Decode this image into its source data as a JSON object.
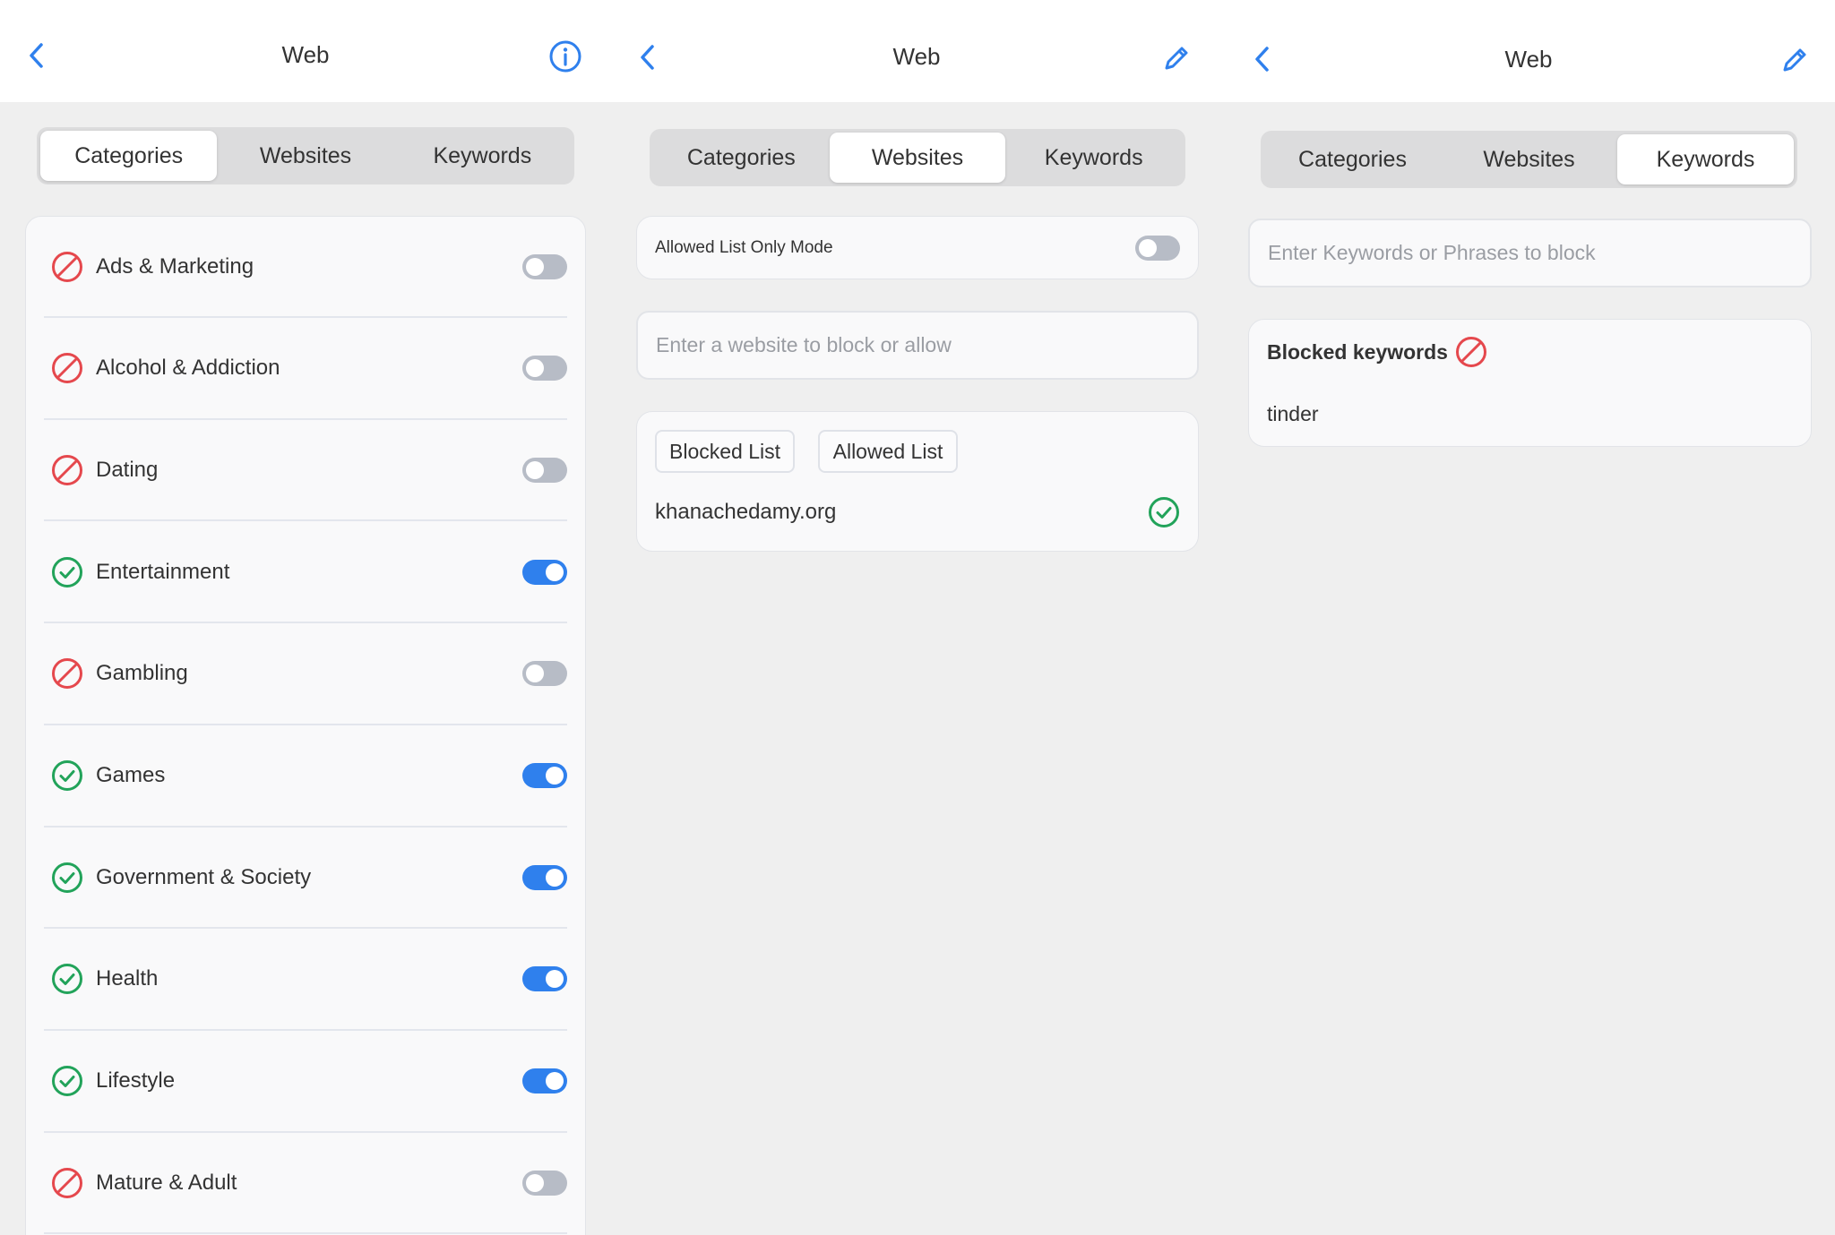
{
  "screen1": {
    "title": "Web",
    "tabs": [
      {
        "label": "Categories",
        "active": true
      },
      {
        "label": "Websites",
        "active": false
      },
      {
        "label": "Keywords",
        "active": false
      }
    ],
    "categories": [
      {
        "label": "Ads & Marketing",
        "status": "blocked",
        "enabled": false
      },
      {
        "label": "Alcohol & Addiction",
        "status": "blocked",
        "enabled": false
      },
      {
        "label": "Dating",
        "status": "blocked",
        "enabled": false
      },
      {
        "label": "Entertainment",
        "status": "allowed",
        "enabled": true
      },
      {
        "label": "Gambling",
        "status": "blocked",
        "enabled": false
      },
      {
        "label": "Games",
        "status": "allowed",
        "enabled": true
      },
      {
        "label": "Government & Society",
        "status": "allowed",
        "enabled": true
      },
      {
        "label": "Health",
        "status": "allowed",
        "enabled": true
      },
      {
        "label": "Lifestyle",
        "status": "allowed",
        "enabled": true
      },
      {
        "label": "Mature & Adult",
        "status": "blocked",
        "enabled": false
      }
    ]
  },
  "screen2": {
    "title": "Web",
    "tabs": [
      {
        "label": "Categories",
        "active": false
      },
      {
        "label": "Websites",
        "active": true
      },
      {
        "label": "Keywords",
        "active": false
      }
    ],
    "allowed_mode_label": "Allowed List Only Mode",
    "allowed_mode_enabled": false,
    "website_input_placeholder": "Enter a website to block or allow",
    "list_buttons": [
      "Blocked List",
      "Allowed List"
    ],
    "sites": [
      {
        "domain": "khanachedamy.org",
        "status": "allowed"
      }
    ]
  },
  "screen3": {
    "title": "Web",
    "tabs": [
      {
        "label": "Categories",
        "active": false
      },
      {
        "label": "Websites",
        "active": false
      },
      {
        "label": "Keywords",
        "active": true
      }
    ],
    "keyword_input_placeholder": "Enter Keywords or Phrases to block",
    "blocked_heading": "Blocked keywords",
    "keywords": [
      "tinder"
    ]
  },
  "colors": {
    "accent": "#2f80ed",
    "blocked": "#e5484d",
    "allowed": "#22a35a",
    "toggle_off": "#b7bcc6"
  },
  "icons": {
    "back": "chevron-left-icon",
    "info": "info-icon",
    "edit": "pencil-icon",
    "blocked": "no-entry-icon",
    "allowed": "check-circle-icon"
  }
}
